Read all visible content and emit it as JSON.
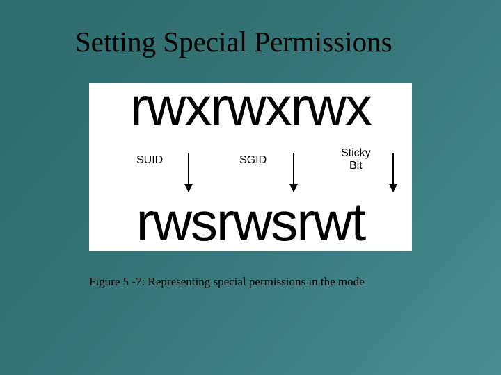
{
  "title": "Setting Special Permissions",
  "permissions": {
    "top": {
      "owner": "rwx",
      "group": "rwx",
      "other": "rwx"
    },
    "labels": {
      "owner": "SUID",
      "group": "SGID",
      "other_line1": "Sticky",
      "other_line2": "Bit"
    },
    "bottom": {
      "owner": "rws",
      "group": "rws",
      "other": "rwt"
    }
  },
  "caption": "Figure 5 -7: Representing special permissions in the mode"
}
